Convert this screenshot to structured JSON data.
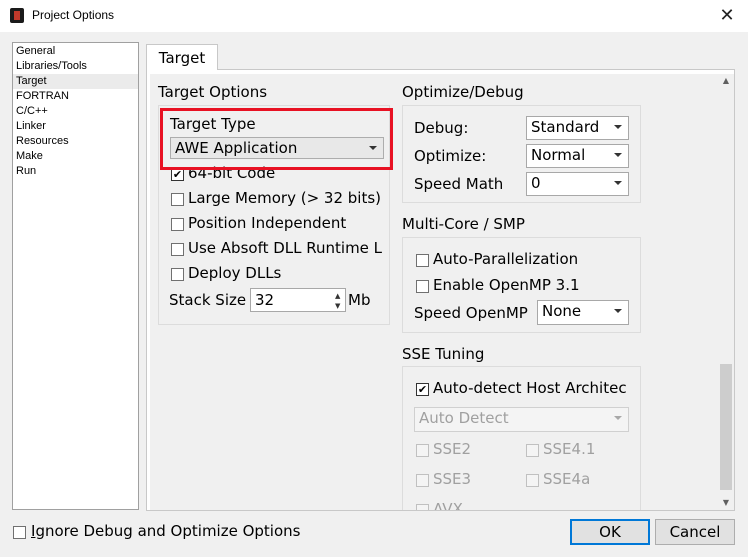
{
  "window": {
    "title": "Project Options",
    "close_glyph": "✕"
  },
  "nav": {
    "items": [
      "General",
      "Libraries/Tools",
      "Target",
      "FORTRAN",
      "C/C++",
      "Linker",
      "Resources",
      "Make",
      "Run"
    ],
    "selected": "Target"
  },
  "tab": {
    "label": "Target"
  },
  "target_options": {
    "title": "Target Options",
    "target_type_label": "Target Type",
    "target_type_value": "AWE Application",
    "checkboxes": [
      {
        "label": "64-bit Code",
        "checked": true
      },
      {
        "label": "Large Memory (> 32 bits)",
        "checked": false
      },
      {
        "label": "Position Independent",
        "checked": false
      },
      {
        "label": "Use Absoft DLL Runtime L",
        "checked": false
      },
      {
        "label": "Deploy DLLs",
        "checked": false
      }
    ],
    "stack_size_label": "Stack Size",
    "stack_size_value": "32",
    "stack_size_unit": "Mb"
  },
  "optimize_debug": {
    "title": "Optimize/Debug",
    "debug_label": "Debug:",
    "debug_value": "Standard",
    "optimize_label": "Optimize:",
    "optimize_value": "Normal",
    "speed_math_label": "Speed Math",
    "speed_math_value": "0"
  },
  "multicore": {
    "title": "Multi-Core / SMP",
    "auto_parallel_label": "Auto-Parallelization",
    "openmp_label": "Enable OpenMP 3.1",
    "speed_openmp_label": "Speed OpenMP",
    "speed_openmp_value": "None"
  },
  "sse": {
    "title": "SSE Tuning",
    "auto_detect_label": "Auto-detect Host Architec",
    "arch_value": "Auto Detect",
    "options": [
      "SSE2",
      "SSE4.1",
      "SSE3",
      "SSE4a",
      "AVX"
    ]
  },
  "footer": {
    "ignore_label": "Ignore Debug and Optimize Options",
    "ignore_mnemonic": "I",
    "ignore_rest": "gnore Debug and Optimize Options",
    "ok": "OK",
    "cancel": "Cancel"
  },
  "colors": {
    "highlight": "#e81123",
    "focus": "#0078d7"
  }
}
